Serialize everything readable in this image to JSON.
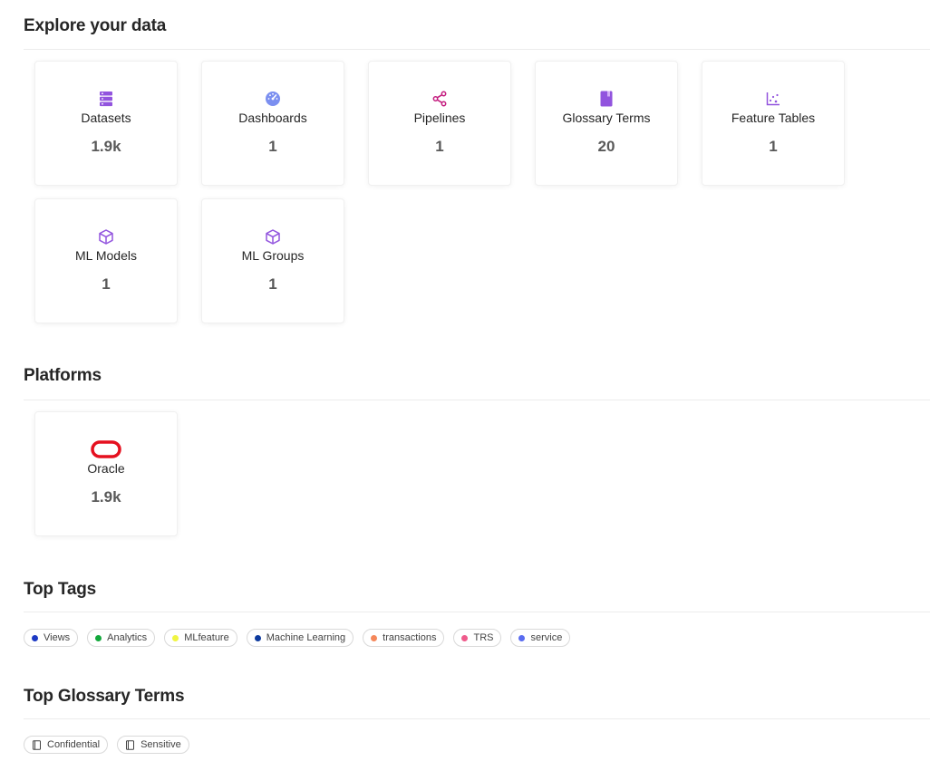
{
  "explore": {
    "title": "Explore your data",
    "cards": [
      {
        "icon": "datasets-icon",
        "label": "Datasets",
        "count": "1.9k",
        "color": "#9254de"
      },
      {
        "icon": "dashboards-icon",
        "label": "Dashboards",
        "count": "1",
        "color": "#7b8ff0"
      },
      {
        "icon": "pipelines-icon",
        "label": "Pipelines",
        "count": "1",
        "color": "#c41d7f"
      },
      {
        "icon": "glossary-icon",
        "label": "Glossary Terms",
        "count": "20",
        "color": "#9254de"
      },
      {
        "icon": "feature-tables-icon",
        "label": "Feature Tables",
        "count": "1",
        "color": "#9254de"
      },
      {
        "icon": "ml-models-icon",
        "label": "ML Models",
        "count": "1",
        "color": "#9254de"
      },
      {
        "icon": "ml-groups-icon",
        "label": "ML Groups",
        "count": "1",
        "color": "#9254de"
      }
    ]
  },
  "platforms": {
    "title": "Platforms",
    "cards": [
      {
        "icon": "oracle-logo-icon",
        "label": "Oracle",
        "count": "1.9k",
        "color": "#e5101f"
      }
    ]
  },
  "top_tags": {
    "title": "Top Tags",
    "tags": [
      {
        "label": "Views",
        "color": "#1d39c4"
      },
      {
        "label": "Analytics",
        "color": "#13a83c"
      },
      {
        "label": "MLfeature",
        "color": "#f0f542"
      },
      {
        "label": "Machine Learning",
        "color": "#0d3a9e"
      },
      {
        "label": "transactions",
        "color": "#f5875a"
      },
      {
        "label": "TRS",
        "color": "#ef5b8c"
      },
      {
        "label": "service",
        "color": "#5a6cf0"
      }
    ]
  },
  "top_glossary": {
    "title": "Top Glossary Terms",
    "terms": [
      {
        "label": "Confidential"
      },
      {
        "label": "Sensitive"
      }
    ]
  }
}
